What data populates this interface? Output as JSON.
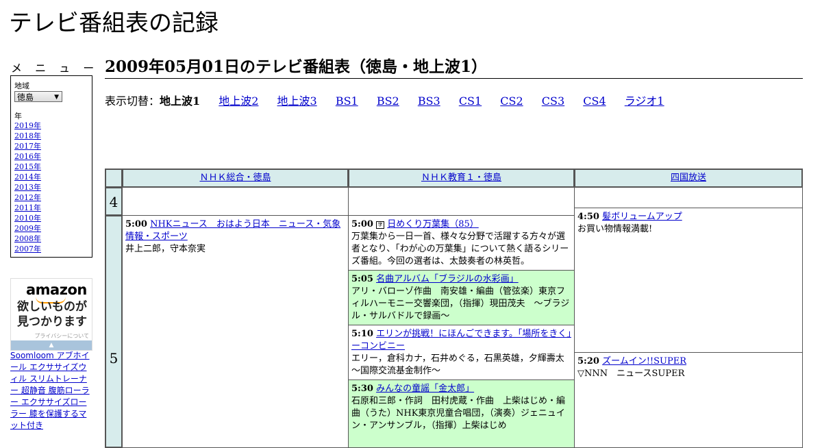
{
  "site_title": "テレビ番組表の記録",
  "sidebar": {
    "menu_label": "メ ニ ュ ー",
    "region_label": "地域",
    "region_selected": "徳島",
    "year_label": "年",
    "years": [
      "2019年",
      "2018年",
      "2017年",
      "2016年",
      "2015年",
      "2014年",
      "2013年",
      "2012年",
      "2011年",
      "2010年",
      "2009年",
      "2008年",
      "2007年"
    ]
  },
  "ad": {
    "logo": "amazon",
    "text1": "欲しいものが",
    "text2": "見つかります",
    "privacy": "プライバシーについて",
    "links": "Soomloom アブホイール エクササイズウィル スリムトレーナー 超静音 腹筋ローラー エクササイズローラー 膝を保護するマット付き"
  },
  "main": {
    "heading": "2009年05月01日のテレビ番組表（徳島・地上波1）",
    "switch_label": "表示切替：",
    "switch_current": "地上波1",
    "switch_links": [
      "地上波2",
      "地上波3",
      "BS1",
      "BS2",
      "BS3",
      "CS1",
      "CS2",
      "CS3",
      "CS4",
      "ラジオ1"
    ]
  },
  "grid": {
    "channels": [
      "ＮＨＫ総合・徳島",
      "ＮＨＫ教育１・徳島",
      "四国放送"
    ],
    "hours": [
      "4",
      "5"
    ],
    "programs": {
      "nhk1_0500": {
        "time": "5:00",
        "title": "NHKニュース　おはよう日本　ニュース・気象情報・スポーツ",
        "desc": "井上二郎，守本奈実"
      },
      "edu_0500": {
        "time": "5:00",
        "icon": "字",
        "title": "日めくり万葉集（85）",
        "desc": "万葉集から一日一首、様々な分野で活躍する方々が選者となり、「わが心の万葉集」について熱く語るシリーズ番組。今回の選者は、太鼓奏者の林英哲。"
      },
      "edu_0505": {
        "time": "5:05",
        "title": "名曲アルバム「ブラジルの水彩画」",
        "desc": "アリ・バローゾ作曲　南安雄・編曲（管弦楽）東京フィルハーモニー交響楽団，（指揮）現田茂夫　～ブラジル・サルバドルで録画～"
      },
      "edu_0510": {
        "time": "5:10",
        "title": "エリンが挑戦！にほんごできます。「場所をきく」ーコンビニー",
        "desc": "エリー，倉科カナ，石井めぐる，石黒英雄，夕輝壽太　～国際交流基金制作～"
      },
      "edu_0530": {
        "time": "5:30",
        "title": "みんなの童謡「金太郎」",
        "desc": "石原和三郎・作詞　田村虎蔵・作曲　上柴はじめ・編曲（うた）NHK東京児童合唱団，（演奏）ジェニュイン・アンサンブル，（指揮）上柴はじめ"
      },
      "shikoku_0450": {
        "time": "4:50",
        "title": "髪ボリュームアップ",
        "desc": "お買い物情報満載!"
      },
      "shikoku_0520": {
        "time": "5:20",
        "title": "ズームイン!!SUPER",
        "desc": "▽NNN　ニュースSUPER"
      }
    }
  },
  "colors": {
    "header_bg": "#d7ecec",
    "highlight_bg": "#ccffcc",
    "link": "#0000cc"
  }
}
